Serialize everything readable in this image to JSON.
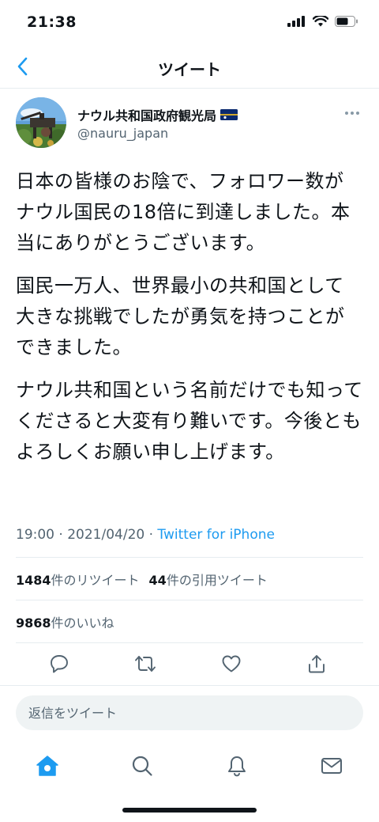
{
  "status_bar": {
    "time": "21:38"
  },
  "nav": {
    "title": "ツイート"
  },
  "author": {
    "name": "ナウル共和国政府観光局",
    "handle": "@nauru_japan"
  },
  "tweet": {
    "paragraphs": [
      "日本の皆様のお陰で、フォロワー数がナウル国民の18倍に到達しました。本当にありがとうございます。",
      "国民一万人、世界最小の共和国として大きな挑戦でしたが勇気を持つことができました。",
      "ナウル共和国という名前だけでも知ってくださると大変有り難いです。今後ともよろしくお願い申し上げます。"
    ],
    "time": "19:00",
    "date": "2021/04/20",
    "separator": "·",
    "source": "Twitter for iPhone"
  },
  "stats": {
    "retweets_count": "1484",
    "retweets_label": "件のリツイート",
    "quotes_count": "44",
    "quotes_label": "件の引用ツイート",
    "likes_count": "9868",
    "likes_label": "件のいいね"
  },
  "reply": {
    "placeholder": "返信をツイート"
  },
  "colors": {
    "accent": "#1d9bf0",
    "text": "#0f1419",
    "secondary": "#536471",
    "border": "#e6ecf0"
  },
  "icons": {
    "back": "chevron-left-icon",
    "more": "more-horizontal-icon",
    "reply": "reply-icon",
    "retweet": "retweet-icon",
    "like": "heart-icon",
    "share": "share-icon",
    "home": "home-icon",
    "search": "search-icon",
    "notifications": "bell-icon",
    "messages": "mail-icon"
  }
}
